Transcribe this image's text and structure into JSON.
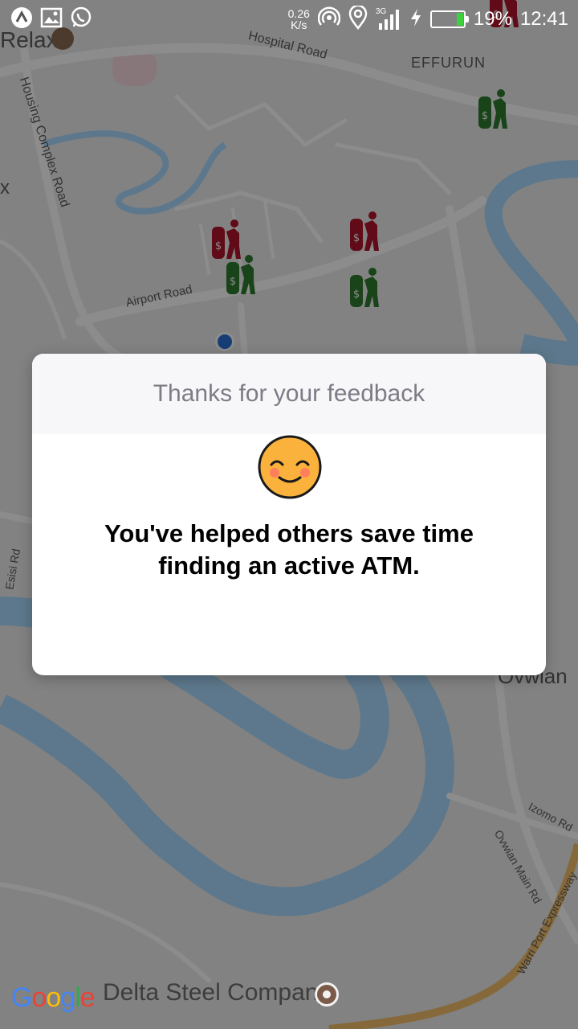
{
  "status_bar": {
    "net_speed_value": "0.26",
    "net_speed_unit": "K/s",
    "network_type": "3G",
    "battery_percent": "19%",
    "battery_level": 0.19,
    "time": "12:41",
    "icons": [
      "app-icon",
      "gallery-icon",
      "whatsapp-icon",
      "hotspot-icon",
      "location-icon",
      "signal-icon",
      "charging-icon",
      "battery-icon"
    ]
  },
  "map": {
    "labels": {
      "relax": "Relax",
      "hospital_road": "Hospital Road",
      "effurun": "EFFURUN",
      "housing_complex_road": "Housing Complex Road",
      "airport_road": "Airport Road",
      "esisi_rd": "Esisi Rd",
      "ovwian": "Ovwian",
      "izomo_rd": "Izomo Rd",
      "ovwian_main_rd": "Ovwian Main Rd",
      "warri_port_expressway": "Warri Port Expressway",
      "edge_x": "x"
    },
    "atm_markers": [
      {
        "status": "inactive",
        "color": "#b0142a"
      },
      {
        "status": "active",
        "color": "#2f7a2f"
      },
      {
        "status": "inactive",
        "color": "#b0142a"
      },
      {
        "status": "active",
        "color": "#2f7a2f"
      },
      {
        "status": "inactive",
        "color": "#b0142a"
      },
      {
        "status": "active",
        "color": "#2f7a2f"
      },
      {
        "status": "active",
        "color": "#2f7a2f"
      }
    ],
    "colors": {
      "land": "#ededed",
      "water": "#aadaff",
      "road": "#ffffff",
      "expressway": "#f5c06b",
      "user_location": "#2b6fd6"
    }
  },
  "dialog": {
    "title": "Thanks for your feedback",
    "message_line1": "You've helped others save time",
    "message_line2": "finding an active ATM.",
    "emoji": "smiling-face-icon"
  },
  "bottom": {
    "google_logo": [
      "G",
      "o",
      "o",
      "g",
      "l",
      "e"
    ],
    "google_colors": [
      "#4285F4",
      "#EA4335",
      "#FBBC05",
      "#4285F4",
      "#34A853",
      "#EA4335"
    ],
    "place_label": "Delta Steel Company"
  }
}
